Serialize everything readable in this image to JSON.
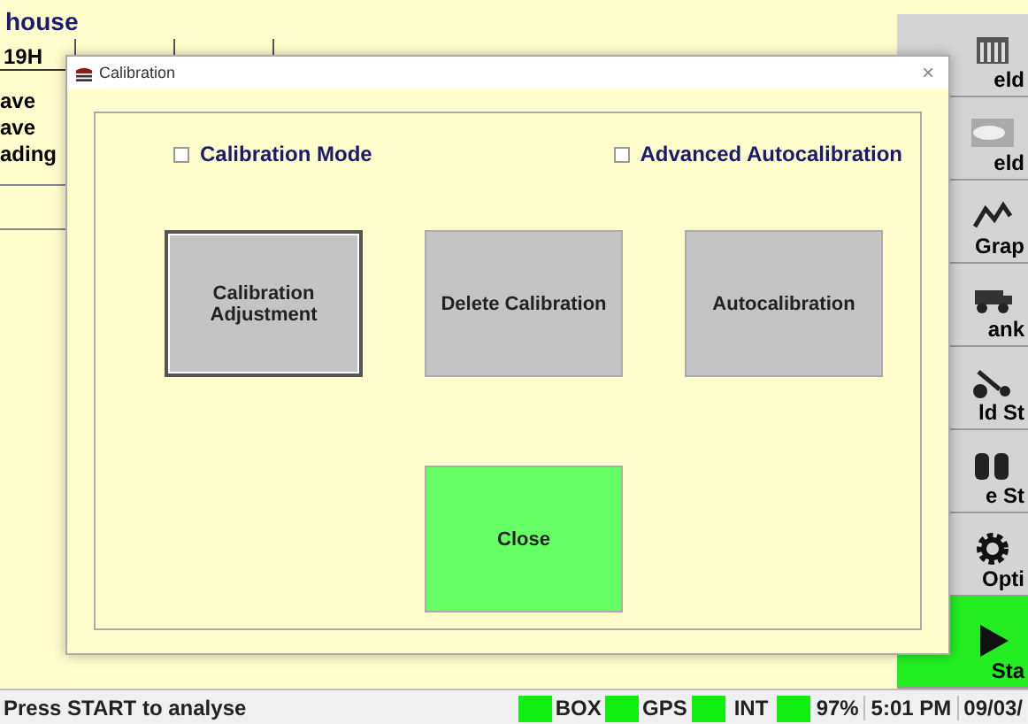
{
  "background": {
    "title": "house",
    "row_label": "19H",
    "lines": [
      "ave",
      "ave",
      "ading"
    ]
  },
  "sidebar": {
    "tiles": [
      {
        "label": "eld",
        "kind": "grid",
        "highlighted": false
      },
      {
        "label": "eld",
        "kind": "photo",
        "highlighted": false
      },
      {
        "label": "Grap",
        "kind": "graph",
        "highlighted": false
      },
      {
        "label": "ank",
        "kind": "truck",
        "highlighted": false
      },
      {
        "label": "ld St",
        "kind": "tractor",
        "highlighted": false
      },
      {
        "label": "e St",
        "kind": "bins",
        "highlighted": false
      },
      {
        "label": "Opti",
        "kind": "gear",
        "highlighted": false
      },
      {
        "label": "Sta",
        "kind": "play",
        "highlighted": true
      }
    ]
  },
  "dialog": {
    "title": "Calibration",
    "close": "×",
    "checkboxes": [
      {
        "label": "Calibration Mode",
        "checked": false
      },
      {
        "label": "Advanced Autocalibration",
        "checked": false
      }
    ],
    "buttons": [
      {
        "label": "Calibration Adjustment",
        "kind": "action",
        "focused": true
      },
      {
        "label": "Delete Calibration",
        "kind": "action",
        "focused": false
      },
      {
        "label": "Autocalibration",
        "kind": "action",
        "focused": false
      },
      {
        "label": "Close",
        "kind": "close",
        "focused": false
      }
    ]
  },
  "status_bar": {
    "message": "Press START to analyse",
    "indicators": [
      {
        "label": "BOX",
        "on": true
      },
      {
        "label": "GPS",
        "on": true
      },
      {
        "label": "INT",
        "on": true
      },
      {
        "label": "97%",
        "on": true
      }
    ],
    "time": "5:01 PM",
    "date": "09/03/"
  }
}
